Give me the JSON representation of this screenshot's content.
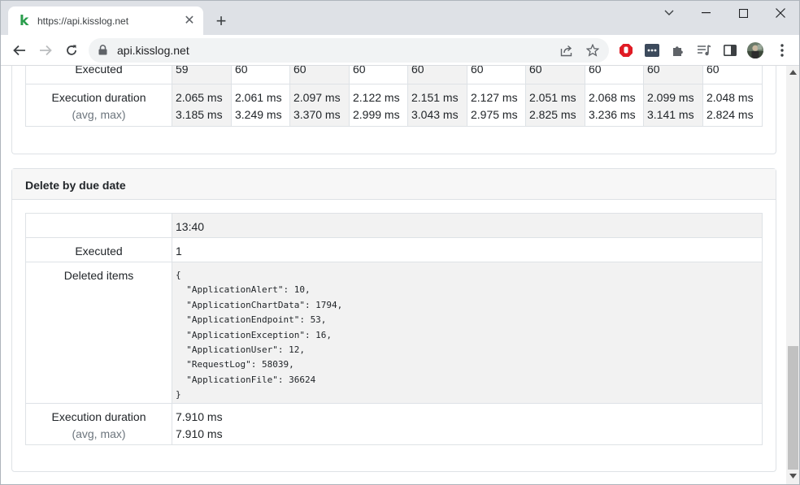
{
  "tab": {
    "title": "https://api.kisslog.net",
    "favicon_letter": "k"
  },
  "address_bar": {
    "url": "api.kisslog.net"
  },
  "section_top": {
    "executed_label": "Executed",
    "executed_values": [
      "59",
      "60",
      "60",
      "60",
      "60",
      "60",
      "60",
      "60",
      "60",
      "60"
    ],
    "duration_label": "Execution duration",
    "duration_sub_label": "(avg, max)",
    "durations": [
      {
        "avg": "2.065 ms",
        "max": "3.185 ms"
      },
      {
        "avg": "2.061 ms",
        "max": "3.249 ms"
      },
      {
        "avg": "2.097 ms",
        "max": "3.370 ms"
      },
      {
        "avg": "2.122 ms",
        "max": "2.999 ms"
      },
      {
        "avg": "2.151 ms",
        "max": "3.043 ms"
      },
      {
        "avg": "2.127 ms",
        "max": "2.975 ms"
      },
      {
        "avg": "2.051 ms",
        "max": "2.825 ms"
      },
      {
        "avg": "2.068 ms",
        "max": "3.236 ms"
      },
      {
        "avg": "2.099 ms",
        "max": "3.141 ms"
      },
      {
        "avg": "2.048 ms",
        "max": "2.824 ms"
      }
    ]
  },
  "section_delete": {
    "title": "Delete by due date",
    "time": "13:40",
    "executed_label": "Executed",
    "executed_value": "1",
    "deleted_label": "Deleted items",
    "deleted_json": "{\n  \"ApplicationAlert\": 10,\n  \"ApplicationChartData\": 1794,\n  \"ApplicationEndpoint\": 53,\n  \"ApplicationException\": 16,\n  \"ApplicationUser\": 12,\n  \"RequestLog\": 58039,\n  \"ApplicationFile\": 36624\n}",
    "duration_label": "Execution duration",
    "duration_sub_label": "(avg, max)",
    "duration_avg": "7.910 ms",
    "duration_max": "7.910 ms"
  }
}
